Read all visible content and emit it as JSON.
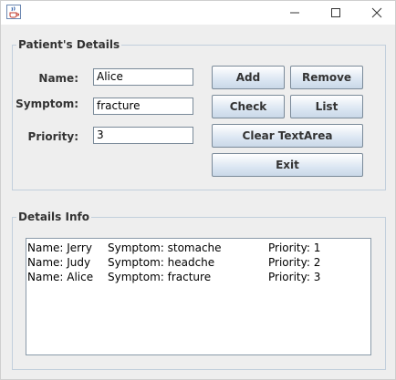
{
  "window": {
    "title": "",
    "icon": "java-cup-icon",
    "controls": {
      "minimize": "─",
      "maximize": "☐",
      "close": "✕"
    }
  },
  "patient_details": {
    "group_title": "Patient's Details",
    "name": {
      "label": "Name:",
      "value": "Alice"
    },
    "symptom": {
      "label": "Symptom:",
      "value": "fracture"
    },
    "priority": {
      "label": "Priority:",
      "value": "3"
    },
    "buttons": {
      "add": "Add",
      "remove": "Remove",
      "check": "Check",
      "list": "List",
      "clear": "Clear TextArea",
      "exit": "Exit"
    }
  },
  "details_info": {
    "group_title": "Details Info",
    "rows": [
      {
        "name": "Name: Jerry",
        "symptom": "Symptom: stomache",
        "priority": "Priority: 1"
      },
      {
        "name": "Name: Judy",
        "symptom": "Symptom: headche",
        "priority": "Priority: 2"
      },
      {
        "name": "Name: Alice",
        "symptom": "Symptom: fracture",
        "priority": "Priority: 3"
      }
    ]
  }
}
